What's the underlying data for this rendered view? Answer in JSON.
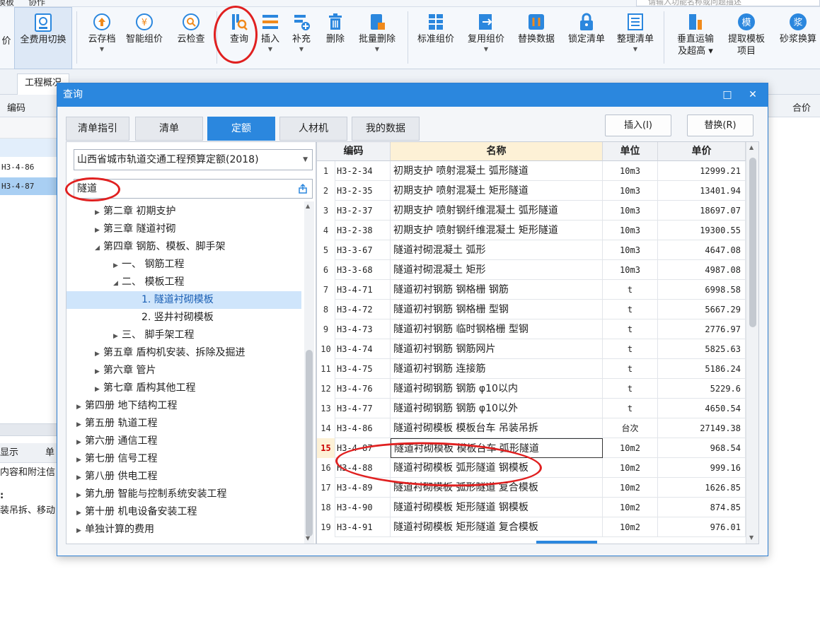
{
  "topbar": {
    "left_text": "模板",
    "left_text2": "协作",
    "search_placeholder": "请输入功能名称或问题描述"
  },
  "ribbon": {
    "buttons": [
      {
        "label": "价",
        "icon": "cut-off"
      },
      {
        "label": "全费用切换",
        "icon": "fee-switch-icon"
      },
      {
        "label": "云存档",
        "icon": "cloud-upload-icon",
        "dropdown": true
      },
      {
        "label": "智能组价",
        "icon": "smart-price-icon"
      },
      {
        "label": "云检查",
        "icon": "cloud-check-icon"
      },
      {
        "label": "查询",
        "icon": "query-icon"
      },
      {
        "label": "插入",
        "icon": "insert-icon",
        "dropdown": true
      },
      {
        "label": "补充",
        "icon": "supplement-icon",
        "dropdown": true
      },
      {
        "label": "删除",
        "icon": "delete-icon"
      },
      {
        "label": "批量删除",
        "icon": "batch-delete-icon",
        "dropdown": true
      },
      {
        "label": "标准组价",
        "icon": "standard-price-icon"
      },
      {
        "label": "复用组价",
        "icon": "reuse-price-icon",
        "dropdown": true
      },
      {
        "label": "替换数据",
        "icon": "replace-data-icon"
      },
      {
        "label": "锁定清单",
        "icon": "lock-list-icon"
      },
      {
        "label": "整理清单",
        "icon": "organize-list-icon",
        "dropdown": true
      },
      {
        "label": "垂直运输",
        "label2": "及超高",
        "icon": "vertical-transport-icon",
        "dropdown": true
      },
      {
        "label": "提取模板",
        "label2": "项目",
        "icon": "template-extract-icon"
      },
      {
        "label": "砂浆换算",
        "icon": "mortar-convert-icon"
      }
    ]
  },
  "background": {
    "tab_label": "工程概况",
    "col_code": "编码",
    "col_total": "合价",
    "rows": [
      "H3-4-86",
      "H3-4-87"
    ],
    "bottom_tab1": "显示",
    "bottom_tab2": "单",
    "bottom_text1": "内容和附注信",
    "bottom_text2": ":",
    "bottom_text3": "装吊拆、移动"
  },
  "dialog": {
    "title": "查询",
    "maximize": "□",
    "close": "✕",
    "tabs": [
      "清单指引",
      "清单",
      "定额",
      "人材机",
      "我的数据"
    ],
    "active_tab": 2,
    "insert_button": "插入(I)",
    "replace_button": "替换(R)",
    "library": "山西省城市轨道交通工程预算定额(2018)",
    "search_value": "隧道",
    "tree": [
      {
        "label": "第二章 初期支护",
        "level": 2,
        "state": "collapsed"
      },
      {
        "label": "第三章 隧道衬砌",
        "level": 2,
        "state": "collapsed"
      },
      {
        "label": "第四章 钢筋、模板、脚手架",
        "level": 2,
        "state": "expanded"
      },
      {
        "label": "一、 钢筋工程",
        "level": 3,
        "state": "collapsed"
      },
      {
        "label": "二、 模板工程",
        "level": 3,
        "state": "expanded"
      },
      {
        "label": "1. 隧道衬砌模板",
        "level": 4,
        "state": "leaf",
        "selected": true
      },
      {
        "label": "2. 竖井衬砌模板",
        "level": 4,
        "state": "leaf"
      },
      {
        "label": "三、 脚手架工程",
        "level": 3,
        "state": "collapsed"
      },
      {
        "label": "第五章 盾构机安装、拆除及掘进",
        "level": 2,
        "state": "collapsed"
      },
      {
        "label": "第六章 管片",
        "level": 2,
        "state": "collapsed"
      },
      {
        "label": "第七章 盾构其他工程",
        "level": 2,
        "state": "collapsed"
      },
      {
        "label": "第四册 地下结构工程",
        "level": 1,
        "state": "collapsed"
      },
      {
        "label": "第五册 轨道工程",
        "level": 1,
        "state": "collapsed"
      },
      {
        "label": "第六册 通信工程",
        "level": 1,
        "state": "collapsed"
      },
      {
        "label": "第七册 信号工程",
        "level": 1,
        "state": "collapsed"
      },
      {
        "label": "第八册 供电工程",
        "level": 1,
        "state": "collapsed"
      },
      {
        "label": "第九册 智能与控制系统安装工程",
        "level": 1,
        "state": "collapsed"
      },
      {
        "label": "第十册 机电设备安装工程",
        "level": 1,
        "state": "collapsed"
      },
      {
        "label": "单独计算的费用",
        "level": 1,
        "state": "collapsed"
      }
    ],
    "grid": {
      "headers": {
        "code": "编码",
        "name": "名称",
        "unit": "单位",
        "price": "单价"
      },
      "rows": [
        {
          "no": "1",
          "code": "H3-2-34",
          "name": "初期支护 喷射混凝土 弧形隧道",
          "unit": "10m3",
          "price": "12999.21"
        },
        {
          "no": "2",
          "code": "H3-2-35",
          "name": "初期支护 喷射混凝土 矩形隧道",
          "unit": "10m3",
          "price": "13401.94"
        },
        {
          "no": "3",
          "code": "H3-2-37",
          "name": "初期支护 喷射钢纤维混凝土 弧形隧道",
          "unit": "10m3",
          "price": "18697.07"
        },
        {
          "no": "4",
          "code": "H3-2-38",
          "name": "初期支护 喷射钢纤维混凝土 矩形隧道",
          "unit": "10m3",
          "price": "19300.55"
        },
        {
          "no": "5",
          "code": "H3-3-67",
          "name": "隧道衬砌混凝土 弧形",
          "unit": "10m3",
          "price": "4647.08"
        },
        {
          "no": "6",
          "code": "H3-3-68",
          "name": "隧道衬砌混凝土 矩形",
          "unit": "10m3",
          "price": "4987.08"
        },
        {
          "no": "7",
          "code": "H3-4-71",
          "name": "隧道初衬钢筋 钢格栅 钢筋",
          "unit": "t",
          "price": "6998.58"
        },
        {
          "no": "8",
          "code": "H3-4-72",
          "name": "隧道初衬钢筋 钢格栅 型钢",
          "unit": "t",
          "price": "5667.29"
        },
        {
          "no": "9",
          "code": "H3-4-73",
          "name": "隧道初衬钢筋 临时钢格栅 型钢",
          "unit": "t",
          "price": "2776.97"
        },
        {
          "no": "10",
          "code": "H3-4-74",
          "name": "隧道初衬钢筋 钢筋网片",
          "unit": "t",
          "price": "5825.63"
        },
        {
          "no": "11",
          "code": "H3-4-75",
          "name": "隧道初衬钢筋 连接筋",
          "unit": "t",
          "price": "5186.24"
        },
        {
          "no": "12",
          "code": "H3-4-76",
          "name": "隧道衬砌钢筋 钢筋 φ10以内",
          "unit": "t",
          "price": "5229.6"
        },
        {
          "no": "13",
          "code": "H3-4-77",
          "name": "隧道衬砌钢筋 钢筋 φ10以外",
          "unit": "t",
          "price": "4650.54"
        },
        {
          "no": "14",
          "code": "H3-4-86",
          "name": "隧道衬砌模板 模板台车 吊装吊拆",
          "unit": "台次",
          "price": "27149.38"
        },
        {
          "no": "15",
          "code": "H3-4-87",
          "name": "隧道衬砌模板 模板台车 弧形隧道",
          "unit": "10m2",
          "price": "968.54",
          "selected": true
        },
        {
          "no": "16",
          "code": "H3-4-88",
          "name": "隧道衬砌模板 弧形隧道 钢模板",
          "unit": "10m2",
          "price": "999.16"
        },
        {
          "no": "17",
          "code": "H3-4-89",
          "name": "隧道衬砌模板 弧形隧道 复合模板",
          "unit": "10m2",
          "price": "1626.85"
        },
        {
          "no": "18",
          "code": "H3-4-90",
          "name": "隧道衬砌模板 矩形隧道 钢模板",
          "unit": "10m2",
          "price": "874.85"
        },
        {
          "no": "19",
          "code": "H3-4-91",
          "name": "隧道衬砌模板 矩形隧道 复合模板",
          "unit": "10m2",
          "price": "976.01"
        }
      ]
    }
  },
  "colors": {
    "accent": "#2b87de",
    "annotation": "#e02020",
    "selection": "#cfe5fb",
    "header_highlight": "#fdf1d6"
  }
}
